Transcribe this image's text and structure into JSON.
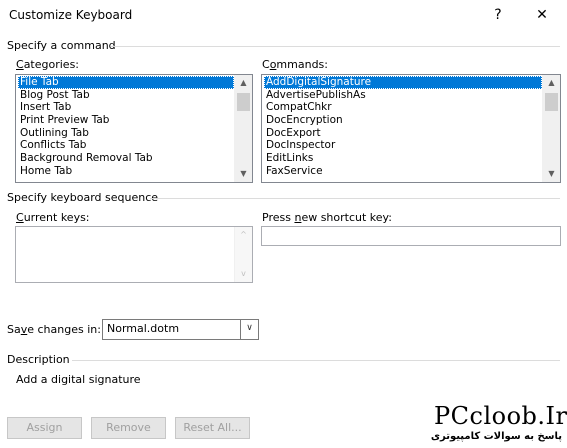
{
  "window": {
    "title": "Customize Keyboard",
    "help": "?",
    "close": "✕"
  },
  "command_section": {
    "label": "Specify a command",
    "categories": {
      "label": "Categories:",
      "items": [
        "File Tab",
        "Blog Post Tab",
        "Insert Tab",
        "Print Preview Tab",
        "Outlining Tab",
        "Conflicts Tab",
        "Background Removal Tab",
        "Home Tab"
      ],
      "selected": "File Tab"
    },
    "commands": {
      "label": "Commands:",
      "items": [
        "AddDigitalSignature",
        "AdvertisePublishAs",
        "CompatChkr",
        "DocEncryption",
        "DocExport",
        "DocInspector",
        "EditLinks",
        "FaxService"
      ],
      "selected": "AddDigitalSignature"
    }
  },
  "keyboard_section": {
    "label": "Specify keyboard sequence",
    "current_keys_label": "Current keys:",
    "press_new_label": "Press new shortcut key:",
    "press_new_value": ""
  },
  "save_changes": {
    "label": "Save changes in:",
    "value": "Normal.dotm"
  },
  "description": {
    "label": "Description",
    "text": "Add a digital signature"
  },
  "buttons": {
    "assign": "Assign",
    "remove": "Remove",
    "reset_all": "Reset All..."
  },
  "watermark": {
    "brand": "PCcloob.Ir",
    "tagline": "پاسخ به سوالات کامپیوتری"
  },
  "icons": {
    "scroll_up": "up-arrow-icon",
    "scroll_down": "down-arrow-icon",
    "dropdown": "chevron-down-icon"
  }
}
